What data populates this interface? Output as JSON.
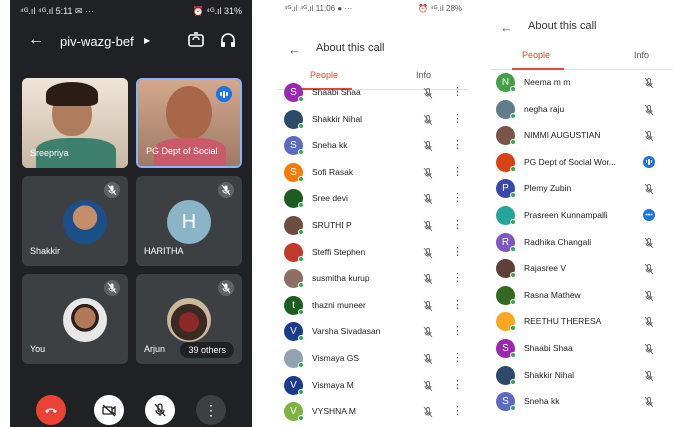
{
  "meet": {
    "status_left": "⁴ᴳ.ıl ⁴ᴳ.ıl 5:11 ✉ ···",
    "status_right": "⏰ ⁴ᴳ.ıl 31%",
    "meeting_code": "piv-wazg-bef",
    "tiles": [
      {
        "name": "Sreepriya"
      },
      {
        "name": "PG Dept of Social"
      },
      {
        "name": "Shakkir"
      },
      {
        "name": "HARITHA",
        "letter": "H"
      },
      {
        "name": "You"
      },
      {
        "name": "Arjun",
        "others": "39 others"
      }
    ],
    "colors": {
      "end_call": "#ea4335",
      "bg": "#202124",
      "tile": "#3c4043"
    }
  },
  "about_left": {
    "status_left": "⁴ᴳ.ıl ⁴ᴳ.ıl 11:06 ● ···",
    "status_right": "⏰ ⁴ᴳ.ıl 28%",
    "title": "About this call",
    "tabs": {
      "people": "People",
      "info": "Info"
    },
    "rows": [
      {
        "name": "Shaabi Shaa",
        "letter": "S",
        "color": "#9c27b0"
      },
      {
        "name": "Shakkir Nihal",
        "letter": "",
        "color": "#2e4a6b"
      },
      {
        "name": "Sneha kk",
        "letter": "S",
        "color": "#5c6bc0"
      },
      {
        "name": "Sofi Rasak",
        "letter": "S",
        "color": "#f57c00"
      },
      {
        "name": "Sree devi",
        "letter": "",
        "color": "#1b5e20"
      },
      {
        "name": "SRUTHI P",
        "letter": "",
        "color": "#6d4c41"
      },
      {
        "name": "Steffi Stephen",
        "letter": "",
        "color": "#c0392b"
      },
      {
        "name": "susmitha kurup",
        "letter": "",
        "color": "#8d6e63"
      },
      {
        "name": "thazni muneer",
        "letter": "t",
        "color": "#1b5e20"
      },
      {
        "name": "Varsha Sivadasan",
        "letter": "V",
        "color": "#1a3a8a"
      },
      {
        "name": "Vismaya GS",
        "letter": "",
        "color": "#90a4ae"
      },
      {
        "name": "Vismaya M",
        "letter": "V",
        "color": "#1a3a8a"
      },
      {
        "name": "VYSHNA M",
        "letter": "V",
        "color": "#7cb342"
      }
    ]
  },
  "about_right": {
    "title": "About this call",
    "tabs": {
      "people": "People",
      "info": "Info"
    },
    "rows": [
      {
        "name": "Neema m m",
        "letter": "N",
        "color": "#43a047"
      },
      {
        "name": "negha raju",
        "letter": "",
        "color": "#607d8b"
      },
      {
        "name": "NIMMI AUGUSTIAN",
        "letter": "",
        "color": "#795548"
      },
      {
        "name": "PG Dept of Social Wor...",
        "letter": "",
        "color": "#d84315",
        "state": "speaking"
      },
      {
        "name": "Plemy Zubin",
        "letter": "P",
        "color": "#3949ab"
      },
      {
        "name": "Prasreen Kunnampalli",
        "letter": "",
        "color": "#26a69a",
        "state": "more"
      },
      {
        "name": "Radhika Changali",
        "letter": "R",
        "color": "#7e57c2"
      },
      {
        "name": "Rajasree V",
        "letter": "",
        "color": "#5d4037"
      },
      {
        "name": "Rasna Mathew",
        "letter": "",
        "color": "#33691e"
      },
      {
        "name": "REETHU THERESA",
        "letter": "",
        "color": "#f9a825"
      },
      {
        "name": "Shaabi Shaa",
        "letter": "S",
        "color": "#9c27b0"
      },
      {
        "name": "Shakkir Nihal",
        "letter": "",
        "color": "#2e4a6b"
      },
      {
        "name": "Sneha kk",
        "letter": "S",
        "color": "#5c6bc0"
      }
    ]
  }
}
